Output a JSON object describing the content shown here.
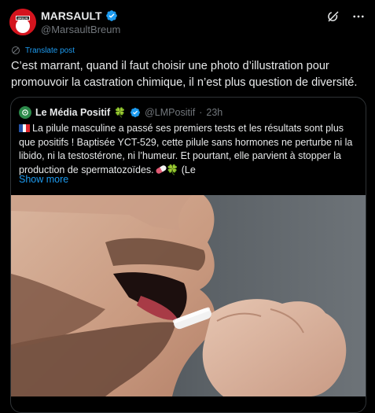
{
  "author": {
    "name": "MARSAULT",
    "handle": "@MarsaultBreum",
    "avatar_label": "BREUM"
  },
  "translate_label": "Translate post",
  "tweet_text": "C’est marrant, quand il faut choisir une photo d’illustration pour promouvoir la castration chimique, il n’est plus question de diversité.",
  "quoted": {
    "name": "Le Média Positif",
    "name_emoji": "🍀",
    "handle": "@LMPositif",
    "separator": "·",
    "time": "23h",
    "text": "La pilule masculine a passé ses premiers tests et les résultats sont plus que positifs ! Baptisée YCT-529, cette pilule sans hormones ne perturbe ni la libido, ni la testostérone, ni l’humeur. Et pourtant, elle parvient à stopper la production de spermatozoïdes.",
    "text_tail": "(Le",
    "clover": "🍀",
    "show_more": "Show more"
  },
  "icons": {
    "verified": "verified-badge-icon",
    "grok": "grok-icon",
    "more": "more-options-icon",
    "translate": "translate-icon",
    "flag": "france-flag-icon",
    "pill": "pill-icon"
  },
  "colors": {
    "background": "#000000",
    "text": "#e7e9ea",
    "muted": "#71767b",
    "accent": "#1d9bf0",
    "border": "#2f3336"
  }
}
